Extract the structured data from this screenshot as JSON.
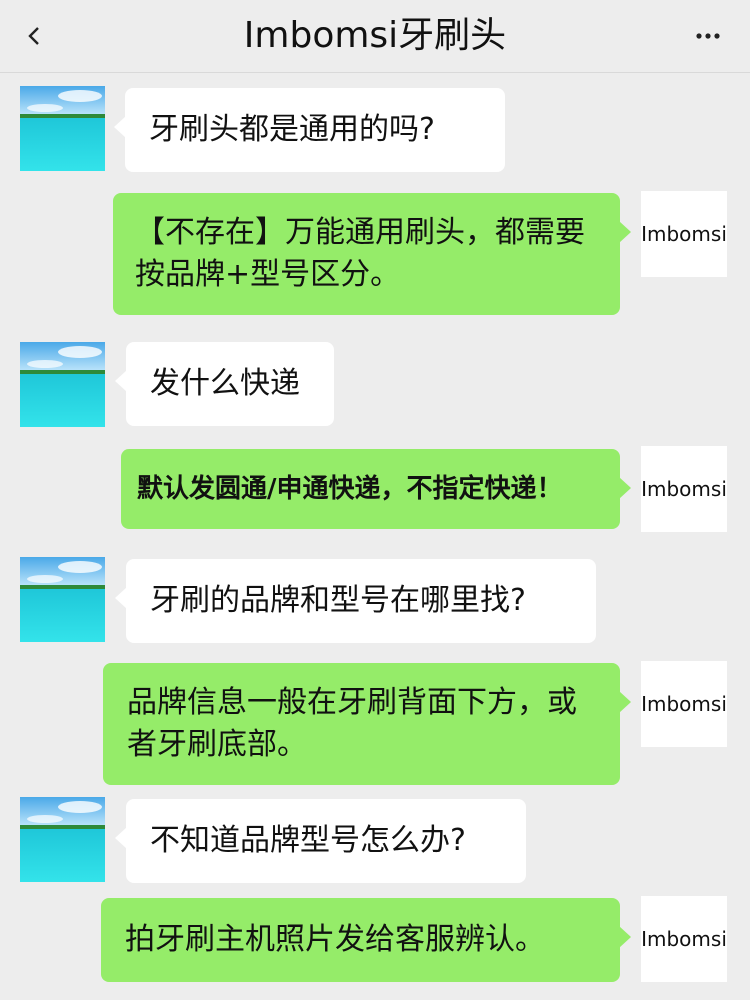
{
  "header": {
    "title": "Imbomsi牙刷头",
    "back_icon": "chevron-left-icon",
    "more_icon": "ellipsis-icon"
  },
  "contact": {
    "name_on_avatar": "Imbomsi"
  },
  "messages": [
    {
      "side": "left",
      "text": "牙刷头都是通用的吗?"
    },
    {
      "side": "right",
      "text": "【不存在】万能通用刷头，都需要按品牌+型号区分。"
    },
    {
      "side": "left",
      "text": "发什么快递"
    },
    {
      "side": "right",
      "text": "默认发圆通/申通快递，不指定快递！"
    },
    {
      "side": "left",
      "text": "牙刷的品牌和型号在哪里找?"
    },
    {
      "side": "right",
      "text": "品牌信息一般在牙刷背面下方，或者牙刷底部。"
    },
    {
      "side": "left",
      "text": "不知道品牌型号怎么办?"
    },
    {
      "side": "right",
      "text": "拍牙刷主机照片发给客服辨认。"
    }
  ],
  "colors": {
    "background": "#ededed",
    "incoming_bubble": "#ffffff",
    "outgoing_bubble": "#95ec69"
  }
}
